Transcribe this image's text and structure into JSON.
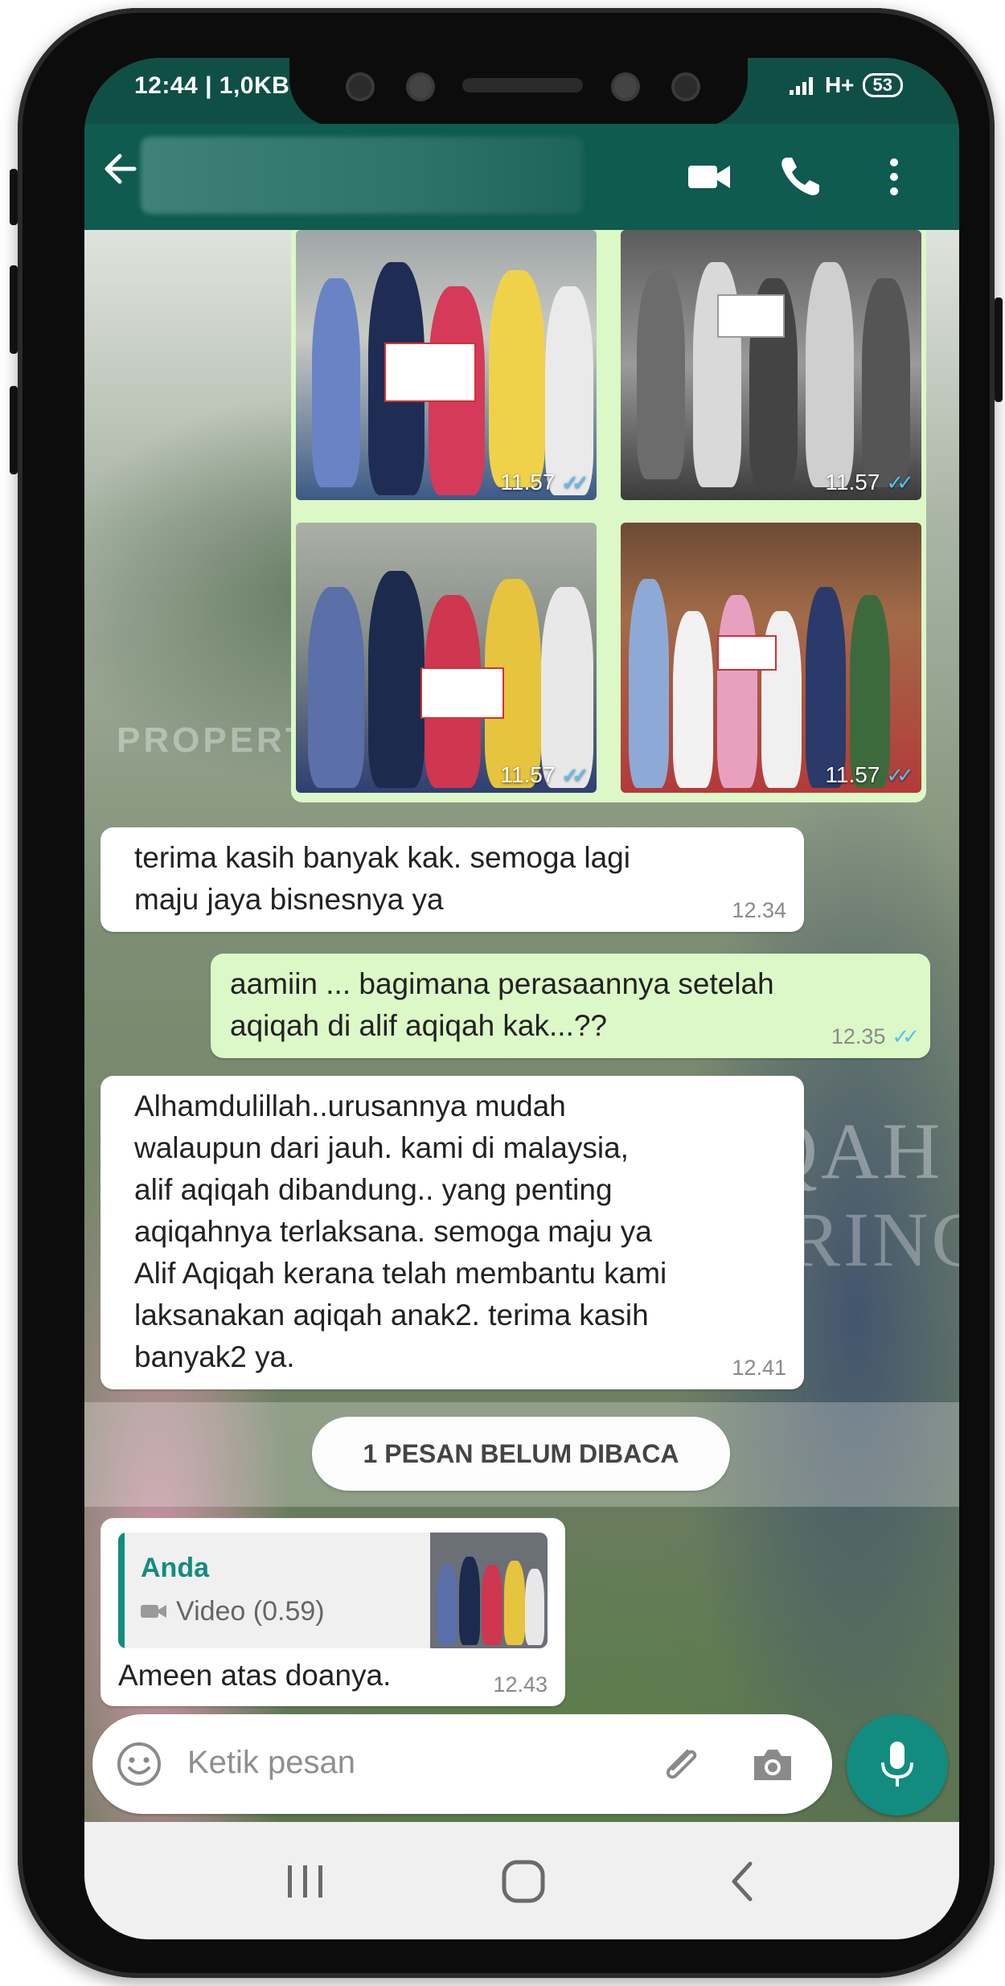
{
  "status_bar": {
    "time": "12:44 | 1,0KB",
    "network": "H+",
    "battery": "53"
  },
  "chat_header": {
    "contact_name": ""
  },
  "watermarks": {
    "brand_line1": "AQIQAH",
    "brand_line2": "CATERING",
    "property": "PROPERTY OF"
  },
  "photos": [
    {
      "time": "11.57"
    },
    {
      "time": "11.57"
    },
    {
      "time": "11.57"
    },
    {
      "time": "11.57"
    }
  ],
  "messages": [
    {
      "direction": "in",
      "text": "terima kasih banyak kak. semoga lagi\nmaju jaya bisnesnya ya",
      "time": "12.34"
    },
    {
      "direction": "out",
      "text": "aamiin ... bagimana perasaannya setelah\naqiqah di alif aqiqah kak...??",
      "time": "12.35"
    },
    {
      "direction": "in",
      "text": "Alhamdulillah..urusannya mudah\nwalaupun dari jauh. kami di malaysia,\nalif aqiqah dibandung.. yang penting\naqiqahnya terlaksana. semoga maju ya\nAlif Aqiqah kerana telah membantu kami\nlaksanakan aqiqah anak2. terima kasih\nbanyak2 ya.",
      "time": "12.41"
    }
  ],
  "unread_banner": "1 PESAN BELUM DIBACA",
  "reply_message": {
    "quoted_sender": "Anda",
    "quoted_type": "Video (0.59)",
    "text": "Ameen atas doanya.",
    "time": "12.43"
  },
  "composer": {
    "placeholder": "Ketik pesan"
  },
  "colors": {
    "header": "#0f5b50",
    "accent": "#128c7e",
    "outgoing_bubble": "#dcf8c6",
    "read_ticks": "#4fc3f7"
  },
  "icons": [
    "back-arrow-icon",
    "video-call-icon",
    "phone-icon",
    "more-options-icon",
    "emoji-icon",
    "attach-icon",
    "camera-icon",
    "mic-icon",
    "recents-icon",
    "home-icon",
    "nav-back-icon"
  ]
}
